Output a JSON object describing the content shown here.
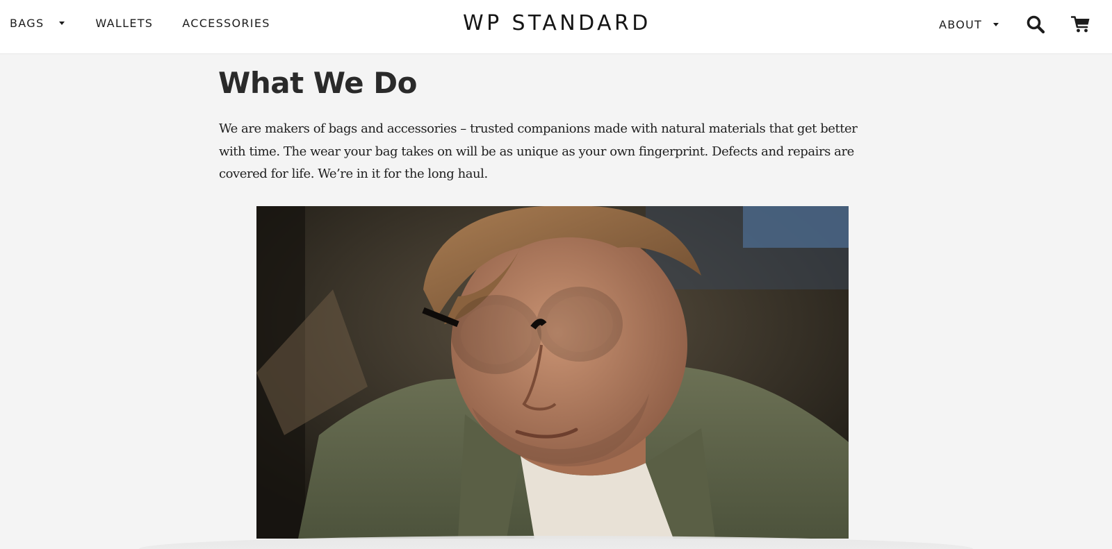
{
  "header": {
    "logo": "WP STANDARD",
    "nav_left": [
      {
        "label": "BAGS",
        "has_dropdown": true
      },
      {
        "label": "WALLETS",
        "has_dropdown": false
      },
      {
        "label": "ACCESSORIES",
        "has_dropdown": false
      }
    ],
    "nav_right": {
      "about_label": "ABOUT",
      "about_has_dropdown": true,
      "icons": [
        "search-icon",
        "cart-icon"
      ]
    }
  },
  "main": {
    "title": "What We Do",
    "intro": "We are makers of bags and accessories – trusted companions made with natural materials that get better with time. The wear your bag takes on will be as unique as your own fingerprint. Defects and repairs are covered for life. We’re in it for the long haul."
  },
  "colors": {
    "page_bg": "#f4f4f4",
    "header_bg": "#ffffff",
    "text": "#222222"
  }
}
